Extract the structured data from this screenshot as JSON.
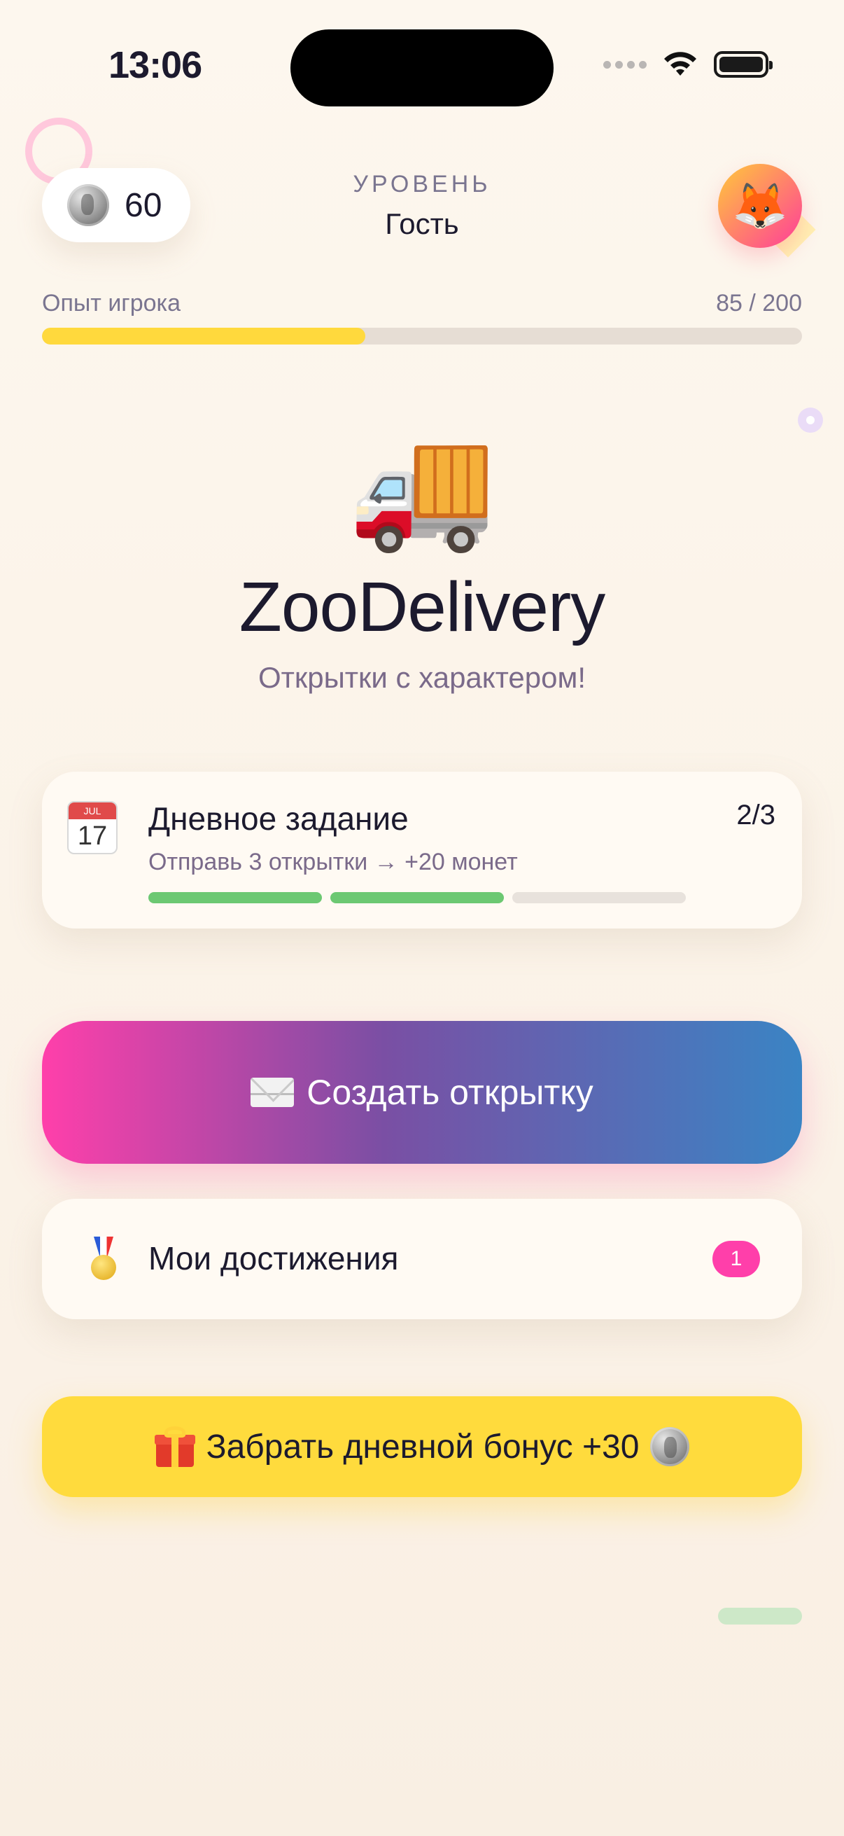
{
  "status_bar": {
    "time": "13:06"
  },
  "header": {
    "coins": "60",
    "level_label": "УРОВЕНЬ",
    "level_value": "Гость",
    "avatar_emoji": "🦊"
  },
  "xp": {
    "label": "Опыт игрока",
    "value_text": "85 / 200",
    "current": 85,
    "max": 200
  },
  "hero": {
    "emoji": "🚚",
    "title": "ZooDelivery",
    "subtitle": "Открытки с характером!"
  },
  "daily_task": {
    "icon_month": "JUL",
    "icon_day": "17",
    "title": "Дневное задание",
    "count": "2/3",
    "description": "Отправь 3 открытки → +20 монет",
    "completed": 2,
    "total": 3
  },
  "create_button": {
    "label": "Создать открытку"
  },
  "achievements": {
    "label": "Мои достижения",
    "badge": "1"
  },
  "bonus_button": {
    "label": "Забрать дневной бонус +30"
  },
  "colors": {
    "accent_pink": "#ff3faa",
    "accent_blue": "#3a84c4",
    "xp_yellow": "#ffd93d",
    "progress_green": "#6cc872",
    "bonus_yellow": "#ffdb3d"
  },
  "icons": {
    "coin": "coin-icon",
    "envelope": "envelope-icon",
    "medal": "medal-icon",
    "gift": "gift-icon",
    "calendar": "calendar-icon"
  }
}
